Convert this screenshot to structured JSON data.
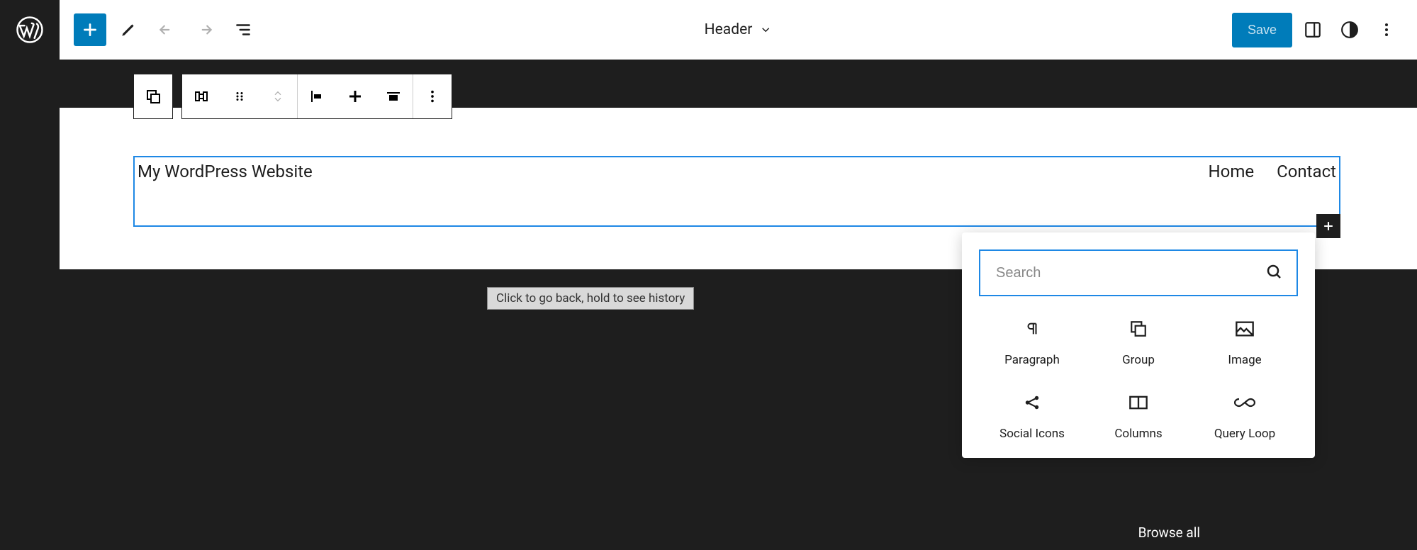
{
  "topbar": {
    "template_label": "Header",
    "save_label": "Save"
  },
  "site": {
    "title": "My WordPress Website",
    "nav": [
      "Home",
      "Contact"
    ]
  },
  "tooltip": {
    "text": "Click to go back, hold to see history"
  },
  "inserter": {
    "search_placeholder": "Search",
    "blocks": [
      {
        "label": "Paragraph",
        "icon": "paragraph-icon"
      },
      {
        "label": "Group",
        "icon": "group-icon"
      },
      {
        "label": "Image",
        "icon": "image-icon"
      },
      {
        "label": "Social Icons",
        "icon": "share-icon"
      },
      {
        "label": "Columns",
        "icon": "columns-icon"
      },
      {
        "label": "Query Loop",
        "icon": "infinity-icon"
      }
    ],
    "browse_all_label": "Browse all"
  }
}
